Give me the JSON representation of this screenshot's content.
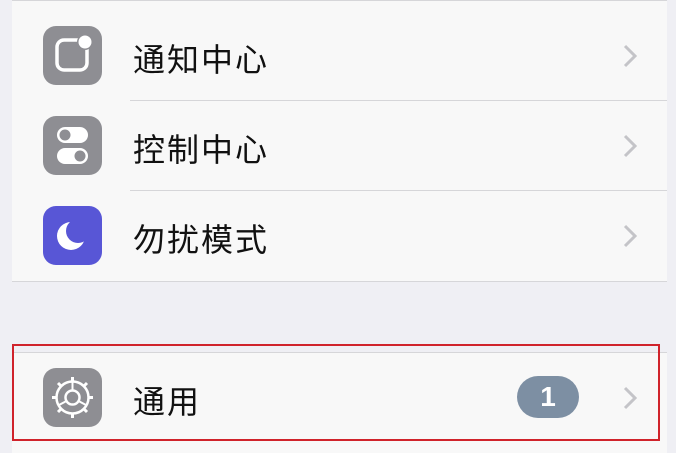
{
  "settings": {
    "items": [
      {
        "label": "通知中心",
        "icon": "notification-center-icon",
        "icon_color": "#8e8e93"
      },
      {
        "label": "控制中心",
        "icon": "control-center-icon",
        "icon_color": "#8e8e93"
      },
      {
        "label": "勿扰模式",
        "icon": "moon-icon",
        "icon_color": "#5856d6"
      }
    ],
    "general": {
      "label": "通用",
      "icon": "gear-icon",
      "icon_color": "#8e8e93",
      "badge": "1"
    }
  },
  "colors": {
    "highlight_border": "#d0232b",
    "badge_bg": "#7d8fa3"
  }
}
